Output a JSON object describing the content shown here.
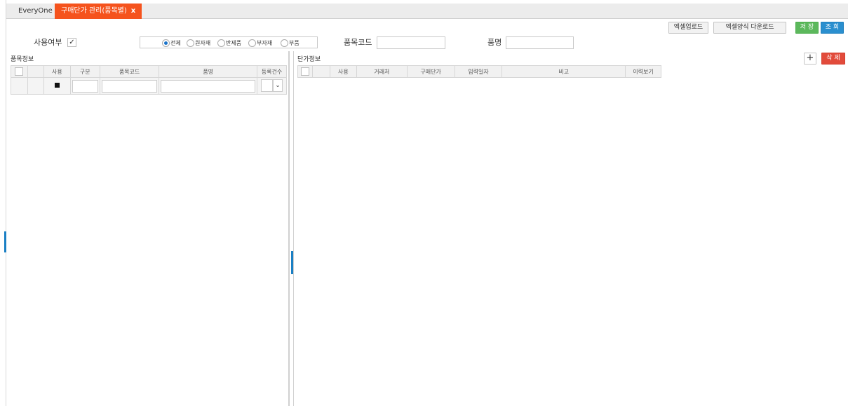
{
  "tabs": {
    "home": "EveryOne",
    "active": "구매단가 관리(품목별)",
    "close": "x"
  },
  "toolbar": {
    "excel_upload": "엑셀업로드",
    "excel_template_download": "엑셀양식 다운로드",
    "save": "저 장",
    "search": "조 회"
  },
  "filter": {
    "use_label": "사용여부",
    "use_checked": "✓",
    "radios": [
      "전체",
      "원자재",
      "반제품",
      "부자재",
      "부품"
    ],
    "selected_radio": "전체",
    "item_code_label": "품목코드",
    "item_code_value": "",
    "item_name_label": "품명",
    "item_name_value": ""
  },
  "left_panel": {
    "title": "품목정보",
    "columns": [
      "",
      "",
      "사용",
      "구분",
      "품목코드",
      "품명",
      "등록건수"
    ]
  },
  "right_panel": {
    "title": "단가정보",
    "add_icon": "+",
    "delete": "삭 제",
    "columns": [
      "",
      "",
      "사용",
      "거래처",
      "구매단가",
      "입력일자",
      "비고",
      "이력보기"
    ]
  },
  "colors": {
    "active_tab": "#f5531d",
    "save_button": "#5cb85c",
    "search_button": "#2a8fcf",
    "delete_button": "#e24b3b",
    "splitter_handle": "#1a7fc4"
  }
}
